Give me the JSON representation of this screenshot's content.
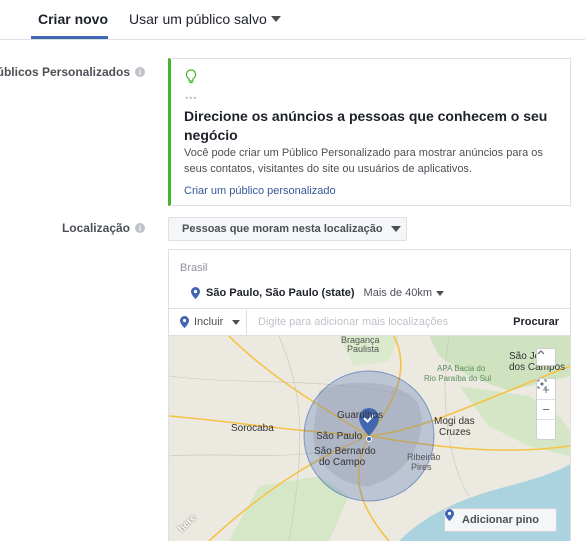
{
  "tabs": {
    "create_new": "Criar novo",
    "use_saved": "Usar um público salvo"
  },
  "custom_audiences": {
    "label": "Públicos Personalizados",
    "title": "Direcione os anúncios a pessoas que conhecem o seu negócio",
    "body": "Você pode criar um Público Personalizado para mostrar anúncios para os seus contatos, visitantes do site ou usuários de aplicativos.",
    "link": "Criar um público personalizado"
  },
  "location": {
    "label": "Localização",
    "dropdown_value": "Pessoas que moram nesta localização",
    "country": "Brasil",
    "selected_location": "São Paulo, São Paulo (state)",
    "radius": "Mais de 40km",
    "include_label": "Incluir",
    "search_placeholder": "Digite para adicionar mais localizações",
    "search_button": "Procurar",
    "add_pin": "Adicionar pino"
  },
  "map": {
    "cities": {
      "braganca": "Bragança",
      "paulista": "Paulista",
      "sao_jose": "São José",
      "dos_campos": "dos Campos",
      "sorocaba": "Sorocaba",
      "guarulhos": "Guarulhos",
      "sao_paulo": "São Paulo",
      "mogi": "Mogi das",
      "cruzes": "Cruzes",
      "sbc1": "São Bernardo",
      "sbc2": "do Campo",
      "ribeirao": "Ribeirão",
      "pires": "Pires",
      "apa": "APA Bacia do",
      "rio": "Rio Paraíba do Sul"
    },
    "attribution": "here"
  },
  "colors": {
    "accent": "#4267b2",
    "link": "#365899",
    "tip_border": "#42b72a",
    "pin": "#4267b2"
  }
}
